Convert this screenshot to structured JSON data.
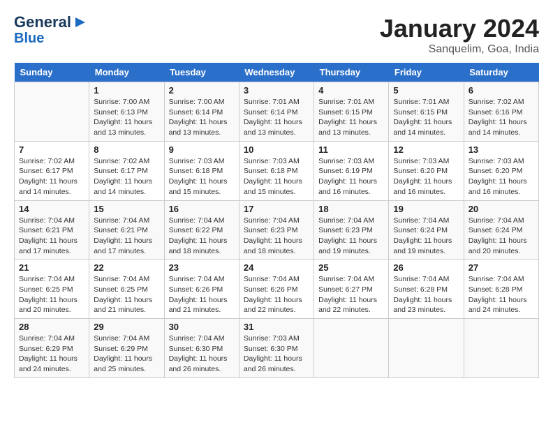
{
  "header": {
    "logo_line1": "General",
    "logo_line2": "Blue",
    "month": "January 2024",
    "location": "Sanquelim, Goa, India"
  },
  "days_of_week": [
    "Sunday",
    "Monday",
    "Tuesday",
    "Wednesday",
    "Thursday",
    "Friday",
    "Saturday"
  ],
  "weeks": [
    [
      {
        "day": "",
        "info": ""
      },
      {
        "day": "1",
        "info": "Sunrise: 7:00 AM\nSunset: 6:13 PM\nDaylight: 11 hours\nand 13 minutes."
      },
      {
        "day": "2",
        "info": "Sunrise: 7:00 AM\nSunset: 6:14 PM\nDaylight: 11 hours\nand 13 minutes."
      },
      {
        "day": "3",
        "info": "Sunrise: 7:01 AM\nSunset: 6:14 PM\nDaylight: 11 hours\nand 13 minutes."
      },
      {
        "day": "4",
        "info": "Sunrise: 7:01 AM\nSunset: 6:15 PM\nDaylight: 11 hours\nand 13 minutes."
      },
      {
        "day": "5",
        "info": "Sunrise: 7:01 AM\nSunset: 6:15 PM\nDaylight: 11 hours\nand 14 minutes."
      },
      {
        "day": "6",
        "info": "Sunrise: 7:02 AM\nSunset: 6:16 PM\nDaylight: 11 hours\nand 14 minutes."
      }
    ],
    [
      {
        "day": "7",
        "info": "Sunrise: 7:02 AM\nSunset: 6:17 PM\nDaylight: 11 hours\nand 14 minutes."
      },
      {
        "day": "8",
        "info": "Sunrise: 7:02 AM\nSunset: 6:17 PM\nDaylight: 11 hours\nand 14 minutes."
      },
      {
        "day": "9",
        "info": "Sunrise: 7:03 AM\nSunset: 6:18 PM\nDaylight: 11 hours\nand 15 minutes."
      },
      {
        "day": "10",
        "info": "Sunrise: 7:03 AM\nSunset: 6:18 PM\nDaylight: 11 hours\nand 15 minutes."
      },
      {
        "day": "11",
        "info": "Sunrise: 7:03 AM\nSunset: 6:19 PM\nDaylight: 11 hours\nand 16 minutes."
      },
      {
        "day": "12",
        "info": "Sunrise: 7:03 AM\nSunset: 6:20 PM\nDaylight: 11 hours\nand 16 minutes."
      },
      {
        "day": "13",
        "info": "Sunrise: 7:03 AM\nSunset: 6:20 PM\nDaylight: 11 hours\nand 16 minutes."
      }
    ],
    [
      {
        "day": "14",
        "info": "Sunrise: 7:04 AM\nSunset: 6:21 PM\nDaylight: 11 hours\nand 17 minutes."
      },
      {
        "day": "15",
        "info": "Sunrise: 7:04 AM\nSunset: 6:21 PM\nDaylight: 11 hours\nand 17 minutes."
      },
      {
        "day": "16",
        "info": "Sunrise: 7:04 AM\nSunset: 6:22 PM\nDaylight: 11 hours\nand 18 minutes."
      },
      {
        "day": "17",
        "info": "Sunrise: 7:04 AM\nSunset: 6:23 PM\nDaylight: 11 hours\nand 18 minutes."
      },
      {
        "day": "18",
        "info": "Sunrise: 7:04 AM\nSunset: 6:23 PM\nDaylight: 11 hours\nand 19 minutes."
      },
      {
        "day": "19",
        "info": "Sunrise: 7:04 AM\nSunset: 6:24 PM\nDaylight: 11 hours\nand 19 minutes."
      },
      {
        "day": "20",
        "info": "Sunrise: 7:04 AM\nSunset: 6:24 PM\nDaylight: 11 hours\nand 20 minutes."
      }
    ],
    [
      {
        "day": "21",
        "info": "Sunrise: 7:04 AM\nSunset: 6:25 PM\nDaylight: 11 hours\nand 20 minutes."
      },
      {
        "day": "22",
        "info": "Sunrise: 7:04 AM\nSunset: 6:25 PM\nDaylight: 11 hours\nand 21 minutes."
      },
      {
        "day": "23",
        "info": "Sunrise: 7:04 AM\nSunset: 6:26 PM\nDaylight: 11 hours\nand 21 minutes."
      },
      {
        "day": "24",
        "info": "Sunrise: 7:04 AM\nSunset: 6:26 PM\nDaylight: 11 hours\nand 22 minutes."
      },
      {
        "day": "25",
        "info": "Sunrise: 7:04 AM\nSunset: 6:27 PM\nDaylight: 11 hours\nand 22 minutes."
      },
      {
        "day": "26",
        "info": "Sunrise: 7:04 AM\nSunset: 6:28 PM\nDaylight: 11 hours\nand 23 minutes."
      },
      {
        "day": "27",
        "info": "Sunrise: 7:04 AM\nSunset: 6:28 PM\nDaylight: 11 hours\nand 24 minutes."
      }
    ],
    [
      {
        "day": "28",
        "info": "Sunrise: 7:04 AM\nSunset: 6:29 PM\nDaylight: 11 hours\nand 24 minutes."
      },
      {
        "day": "29",
        "info": "Sunrise: 7:04 AM\nSunset: 6:29 PM\nDaylight: 11 hours\nand 25 minutes."
      },
      {
        "day": "30",
        "info": "Sunrise: 7:04 AM\nSunset: 6:30 PM\nDaylight: 11 hours\nand 26 minutes."
      },
      {
        "day": "31",
        "info": "Sunrise: 7:03 AM\nSunset: 6:30 PM\nDaylight: 11 hours\nand 26 minutes."
      },
      {
        "day": "",
        "info": ""
      },
      {
        "day": "",
        "info": ""
      },
      {
        "day": "",
        "info": ""
      }
    ]
  ]
}
